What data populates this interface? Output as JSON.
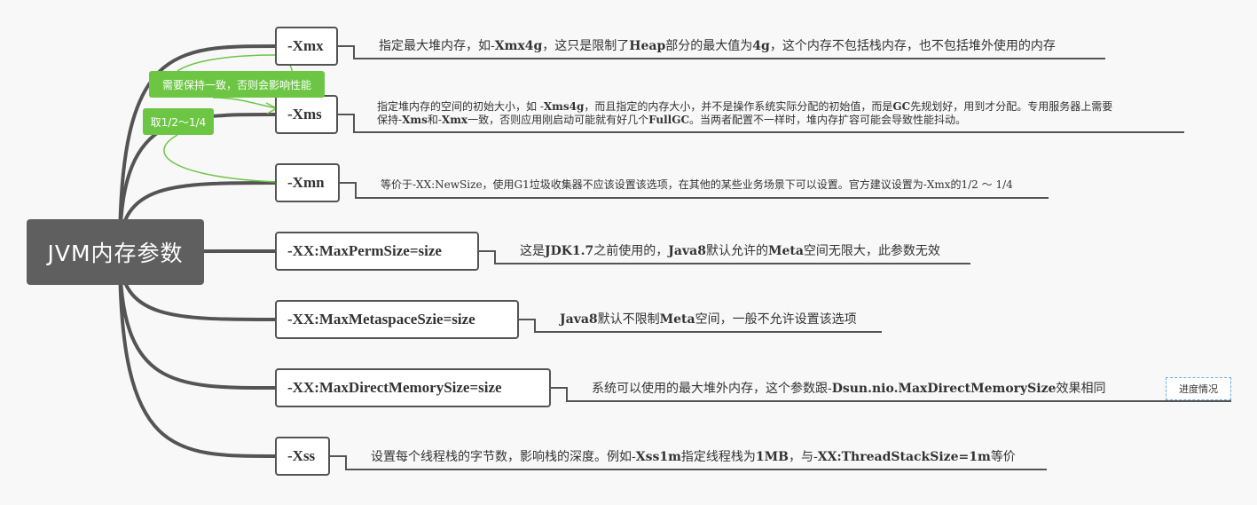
{
  "root": {
    "label": "JVM内存参数"
  },
  "params": [
    {
      "name": "-Xmx",
      "desc": [
        [
          {
            "t": "指定最大堆内存，如-"
          },
          {
            "t": "Xmx4g",
            "b": true
          },
          {
            "t": "，这只是限制了"
          },
          {
            "t": "Heap",
            "b": true
          },
          {
            "t": "部分的最大值为"
          },
          {
            "t": "4g",
            "b": true
          },
          {
            "t": "，这个内存不包括栈内存，也不包括堆外使用的内存"
          }
        ]
      ]
    },
    {
      "name": "-Xms",
      "desc": [
        [
          {
            "t": "指定堆内存的空间的初始大小，如 -"
          },
          {
            "t": "Xms4g",
            "b": true
          },
          {
            "t": "，而且指定的内存大小，并不是操作系统实际分配的初始值，而是"
          },
          {
            "t": "GC",
            "b": true
          },
          {
            "t": "先规划好，用到才分配。专用服务器上需要"
          }
        ],
        [
          {
            "t": "保持-"
          },
          {
            "t": "Xms",
            "b": true
          },
          {
            "t": "和-"
          },
          {
            "t": "Xmx",
            "b": true
          },
          {
            "t": "一致，否则应用刚启动可能就有好几个"
          },
          {
            "t": "FullGC",
            "b": true
          },
          {
            "t": "。当两者配置不一样时，堆内存扩容可能会导致性能抖动。"
          }
        ]
      ]
    },
    {
      "name": "-Xmn",
      "desc": [
        [
          {
            "t": "等价于-XX:NewSize，使用G1垃圾收集器不应该设置该选项，在其他的某些业务场景下可以设置。官方建议设置为-Xmx的1/2 ～ 1/4"
          }
        ]
      ]
    },
    {
      "name": "-XX:MaxPermSize=size",
      "desc": [
        [
          {
            "t": "这是"
          },
          {
            "t": "JDK1.7",
            "b": true
          },
          {
            "t": "之前使用的，"
          },
          {
            "t": "Java8",
            "b": true
          },
          {
            "t": "默认允许的"
          },
          {
            "t": "Meta",
            "b": true
          },
          {
            "t": "空间无限大，此参数无效"
          }
        ]
      ]
    },
    {
      "name": "-XX:MaxMetaspaceSzie=size",
      "desc": [
        [
          {
            "t": "Java8",
            "b": true
          },
          {
            "t": "默认不限制"
          },
          {
            "t": "Meta",
            "b": true
          },
          {
            "t": "空间，一般不允许设置该选项"
          }
        ]
      ]
    },
    {
      "name": "-XX:MaxDirectMemorySize=size",
      "desc": [
        [
          {
            "t": "系统可以使用的最大堆外内存，这个参数跟-"
          },
          {
            "t": "Dsun.nio.MaxDirectMemorySize",
            "b": true
          },
          {
            "t": "效果相同"
          }
        ]
      ]
    },
    {
      "name": "-Xss",
      "desc": [
        [
          {
            "t": "设置每个线程栈的字节数，影响栈的深度。例如-"
          },
          {
            "t": "Xss1m",
            "b": true
          },
          {
            "t": "指定线程栈为"
          },
          {
            "t": "1MB",
            "b": true
          },
          {
            "t": "，与-"
          },
          {
            "t": "XX:ThreadStackSize=1m",
            "b": true
          },
          {
            "t": "等价"
          }
        ]
      ]
    }
  ],
  "callouts": [
    {
      "label": "需要保持一致，否则会影响性能"
    },
    {
      "label": "取1/2～1/4"
    }
  ],
  "tag": {
    "label": "进度情况"
  },
  "colors": {
    "branch": "#545454",
    "callout": "#6cc644",
    "tag_border": "#6aaed6",
    "root": "#5f5f5f"
  }
}
